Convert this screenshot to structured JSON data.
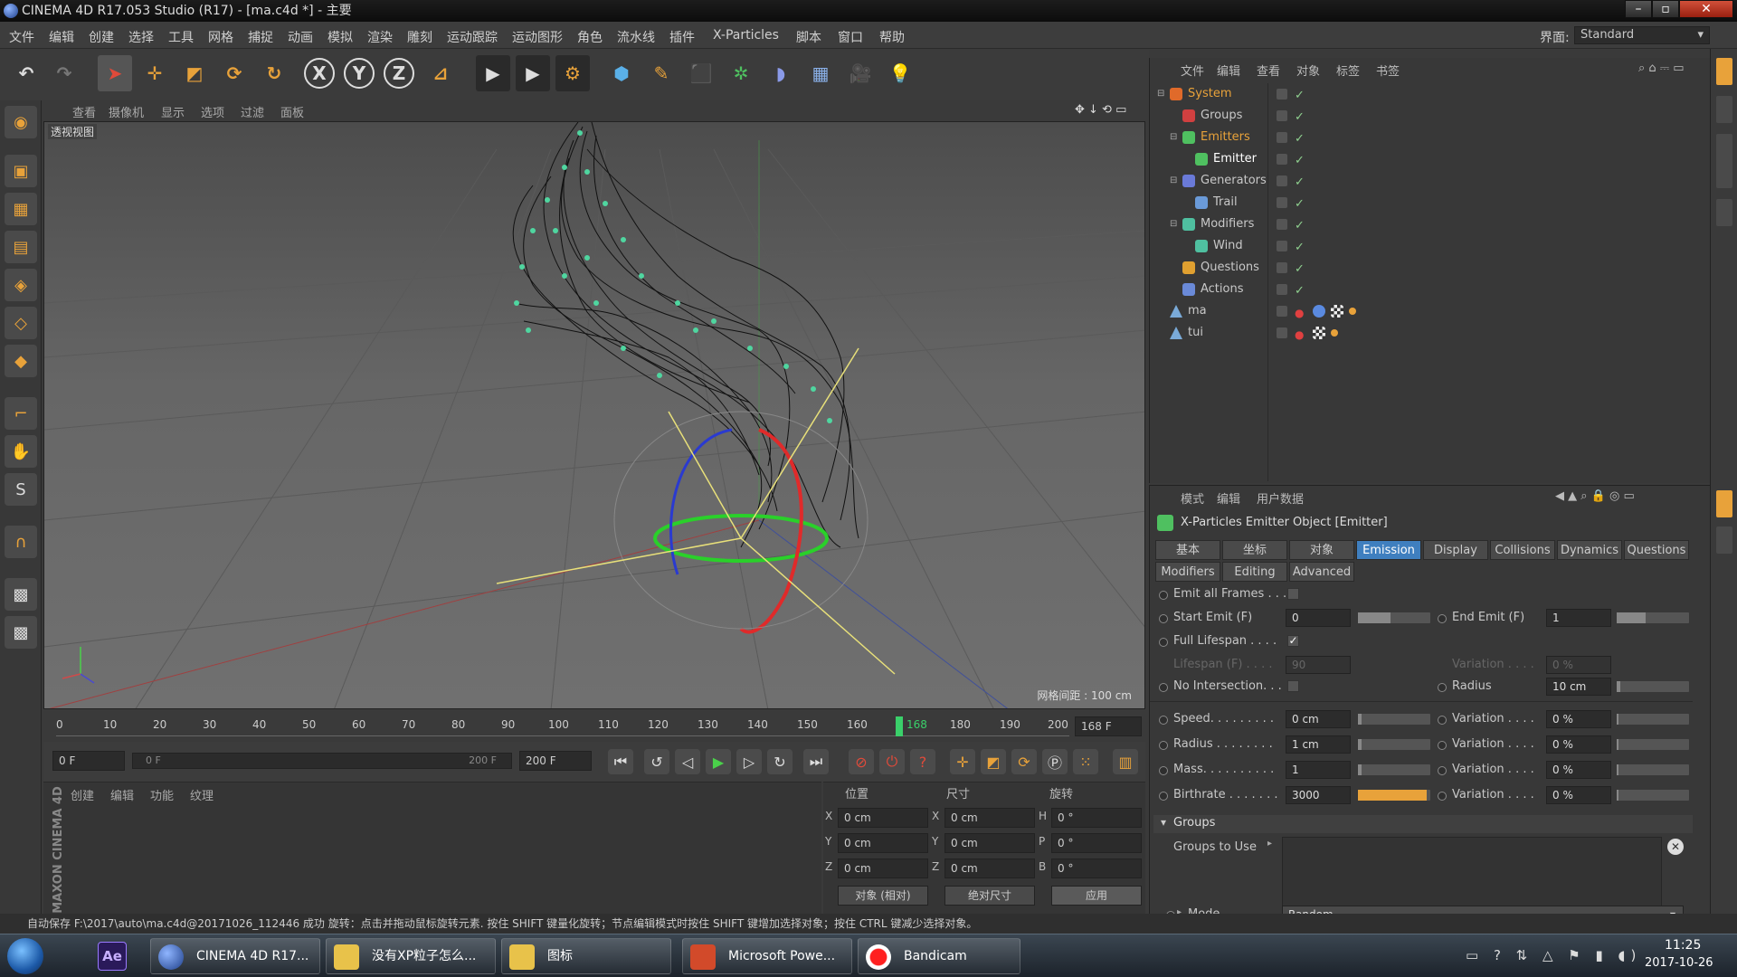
{
  "window": {
    "title": "CINEMA 4D R17.053 Studio (R17) - [ma.c4d *] - 主要",
    "layout_label": "界面:",
    "layout_value": "Standard"
  },
  "menubar": [
    "文件",
    "编辑",
    "创建",
    "选择",
    "工具",
    "网格",
    "捕捉",
    "动画",
    "模拟",
    "渲染",
    "雕刻",
    "运动跟踪",
    "运动图形",
    "角色",
    "流水线",
    "插件",
    "X-Particles",
    "脚本",
    "窗口",
    "帮助"
  ],
  "toolbar_icons": [
    "undo-icon",
    "redo-icon",
    "select-icon",
    "move-icon",
    "scale-icon",
    "rotate-icon",
    "rotate2-icon",
    "x-axis-icon",
    "y-axis-icon",
    "z-axis-icon",
    "coord-icon",
    "render-view-icon",
    "render-icon",
    "render-settings-icon",
    "cube-icon",
    "pen-icon",
    "generator-icon",
    "mograph-icon",
    "deformer-icon",
    "floor-icon",
    "camera-icon",
    "light-icon"
  ],
  "axis_labels": {
    "x": "X",
    "y": "Y",
    "z": "Z"
  },
  "viewport": {
    "menu": [
      "查看",
      "摄像机",
      "显示",
      "选项",
      "过滤",
      "面板"
    ],
    "label": "透视视图",
    "grid_info": "网格间距 : 100 cm",
    "accent": "#4fd6a0"
  },
  "timeline": {
    "ticks": [
      "0",
      "10",
      "20",
      "30",
      "40",
      "50",
      "60",
      "70",
      "80",
      "90",
      "100",
      "110",
      "120",
      "130",
      "140",
      "150",
      "160",
      "168",
      "180",
      "190",
      "200"
    ],
    "current": "168",
    "current_frame": "168 F"
  },
  "transport": {
    "start": "0 F",
    "range_start": "0 F",
    "range_end": "200 F",
    "end": "200 F"
  },
  "material_panel": {
    "menu": [
      "创建",
      "编辑",
      "功能",
      "纹理"
    ],
    "brand": "MAXON CINEMA 4D"
  },
  "coords": {
    "headers": [
      "位置",
      "尺寸",
      "旋转"
    ],
    "rows": [
      {
        "axis": "X",
        "pos": "0 cm",
        "size_axis": "X",
        "size": "0 cm",
        "rot_axis": "H",
        "rot": "0 °"
      },
      {
        "axis": "Y",
        "pos": "0 cm",
        "size_axis": "Y",
        "size": "0 cm",
        "rot_axis": "P",
        "rot": "0 °"
      },
      {
        "axis": "Z",
        "pos": "0 cm",
        "size_axis": "Z",
        "size": "0 cm",
        "rot_axis": "B",
        "rot": "0 °"
      }
    ],
    "mode1": "对象 (相对)",
    "mode2": "绝对尺寸",
    "apply": "应用"
  },
  "object_manager": {
    "menu": [
      "文件",
      "编辑",
      "查看",
      "对象",
      "标签",
      "书签"
    ],
    "items": [
      {
        "name": "System",
        "indent": 0,
        "color": "#e06a2a",
        "highlight": true
      },
      {
        "name": "Groups",
        "indent": 1,
        "color": "#d04040",
        "highlight": false
      },
      {
        "name": "Emitters",
        "indent": 1,
        "color": "#4fc060",
        "highlight": true
      },
      {
        "name": "Emitter",
        "indent": 2,
        "color": "#4fc060",
        "highlight": false,
        "selected": true
      },
      {
        "name": "Generators",
        "indent": 1,
        "color": "#6a7ad8",
        "highlight": false
      },
      {
        "name": "Trail",
        "indent": 2,
        "color": "#6a9ad8",
        "highlight": false
      },
      {
        "name": "Modifiers",
        "indent": 1,
        "color": "#4fc0a0",
        "highlight": false
      },
      {
        "name": "Wind",
        "indent": 2,
        "color": "#4fc0a0",
        "highlight": false
      },
      {
        "name": "Questions",
        "indent": 1,
        "color": "#e0a030",
        "highlight": false
      },
      {
        "name": "Actions",
        "indent": 1,
        "color": "#6a8ad8",
        "highlight": false
      },
      {
        "name": "ma",
        "indent": 0,
        "color": "#7aaad8",
        "highlight": false
      },
      {
        "name": "tui",
        "indent": 0,
        "color": "#7aaad8",
        "highlight": false
      }
    ]
  },
  "attributes": {
    "menu": [
      "模式",
      "编辑",
      "用户数据"
    ],
    "title": "X-Particles Emitter Object [Emitter]",
    "tabs_row1": [
      "基本",
      "坐标",
      "对象",
      "Emission",
      "Display",
      "Collisions",
      "Dynamics",
      "Questions"
    ],
    "tabs_row2": [
      "Modifiers",
      "Editing",
      "Advanced"
    ],
    "active_tab": "Emission",
    "emit_all_frames": "Emit all Frames . . .",
    "start_emit_label": "Start Emit (F)",
    "start_emit": "0",
    "end_emit_label": "End Emit (F)",
    "end_emit": "1",
    "full_lifespan": "Full Lifespan . . . .",
    "lifespan_label": "Lifespan (F) . . . .",
    "lifespan": "90",
    "lifespan_var_label": "Variation . . . .",
    "lifespan_var": "0 %",
    "no_intersection": "No Intersection. . .",
    "radius_label": "Radius",
    "radius_ni": "10 cm",
    "params": [
      {
        "label": "Speed. . . . . . . . .",
        "value": "0 cm",
        "var": "0 %",
        "fill": 0.05
      },
      {
        "label": "Radius . . . . . . . .",
        "value": "1 cm",
        "var": "0 %",
        "fill": 0.05
      },
      {
        "label": "Mass. . . . . . . . . .",
        "value": "1",
        "var": "0 %",
        "fill": 0.05
      },
      {
        "label": "Birthrate . . . . . . .",
        "value": "3000",
        "var": "0 %",
        "fill": 0.95
      }
    ],
    "variation_label": "Variation . . . .",
    "groups_section": "Groups",
    "groups_to_use": "Groups to Use",
    "mode_label": "Mode . . . . . . . .",
    "mode_value": "Random"
  },
  "status": "自动保存 F:\\2017\\auto\\ma.c4d@20171026_112446 成功   旋转：点击并拖动鼠标旋转元素. 按住 SHIFT 键量化旋转；节点编辑模式时按住 SHIFT 键增加选择对象；按住 CTRL 键减少选择对象。",
  "taskbar": {
    "items": [
      {
        "label": "Ae",
        "color": "#2a1a5a"
      },
      {
        "label": "CINEMA 4D R17...",
        "color": "#1e3f8a"
      },
      {
        "label": "没有XP粒子怎么...",
        "color": "#e8c24a"
      },
      {
        "label": "图标",
        "color": "#e8c24a"
      },
      {
        "label": "Microsoft Powe...",
        "color": "#d24a2a"
      },
      {
        "label": "Bandicam",
        "color": "#c01010"
      }
    ],
    "time": "11:25",
    "date": "2017-10-26"
  }
}
